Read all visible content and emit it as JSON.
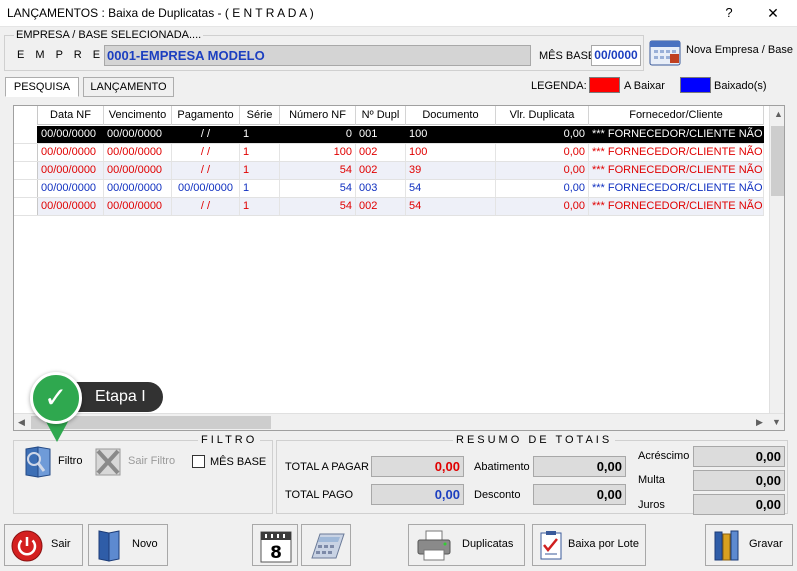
{
  "window": {
    "title": "LANÇAMENTOS : Baixa de Duplicatas - ( E N T R A D A )",
    "help": "?",
    "close": "✕"
  },
  "empresa": {
    "caption": "EMPRESA  /  BASE  SELECIONADA....",
    "label": "E M P R E S A",
    "value": "0001-EMPRESA MODELO",
    "mes_label": "MÊS BASE",
    "mes_value": "00/0000",
    "nova_button": "Nova Empresa / Base"
  },
  "tabs": [
    {
      "label": "PESQUISA",
      "active": true
    },
    {
      "label": "LANÇAMENTO",
      "active": false
    }
  ],
  "legend": {
    "label": "LEGENDA:",
    "items": [
      {
        "label": "A Baixar",
        "color": "#ff0000"
      },
      {
        "label": "Baixado(s)",
        "color": "#0000ff"
      }
    ]
  },
  "grid": {
    "columns": [
      "Data NF",
      "Vencimento",
      "Pagamento",
      "Série",
      "Número NF",
      "Nº Dupl",
      "Documento",
      "Vlr. Duplicata",
      "Fornecedor/Cliente"
    ],
    "rows": [
      {
        "status": "sel",
        "cells": [
          "00/00/0000",
          "00/00/0000",
          "/ /",
          "1",
          "0",
          "001",
          "100",
          "0,00",
          "*** FORNECEDOR/CLIENTE  NÃO"
        ]
      },
      {
        "status": "red",
        "cells": [
          "00/00/0000",
          "00/00/0000",
          "/ /",
          "1",
          "100",
          "002",
          "100",
          "0,00",
          "*** FORNECEDOR/CLIENTE  NÃO"
        ]
      },
      {
        "status": "red",
        "cells": [
          "00/00/0000",
          "00/00/0000",
          "/ /",
          "1",
          "54",
          "002",
          "39",
          "0,00",
          "*** FORNECEDOR/CLIENTE  NÃO"
        ]
      },
      {
        "status": "blue",
        "cells": [
          "00/00/0000",
          "00/00/0000",
          "00/00/0000",
          "1",
          "54",
          "003",
          "54",
          "0,00",
          "*** FORNECEDOR/CLIENTE  NÃO"
        ]
      },
      {
        "status": "red",
        "cells": [
          "00/00/0000",
          "00/00/0000",
          "/ /",
          "1",
          "54",
          "002",
          "54",
          "0,00",
          "*** FORNECEDOR/CLIENTE  NÃO"
        ]
      }
    ]
  },
  "callout": {
    "label": "Etapa I"
  },
  "filtro": {
    "caption": "FILTRO",
    "filtro_button": "Filtro",
    "sair_filtro_button": "Sair Filtro",
    "mes_base_check": "MÊS BASE"
  },
  "resumo": {
    "caption": "RESUMO  DE  TOTAIS",
    "total_pagar_label": "TOTAL A PAGAR",
    "total_pagar_value": "0,00",
    "total_pago_label": "TOTAL PAGO",
    "total_pago_value": "0,00",
    "abatimento_label": "Abatimento",
    "abatimento_value": "0,00",
    "desconto_label": "Desconto",
    "desconto_value": "0,00",
    "acrescimo_label": "Acréscimo",
    "acrescimo_value": "0,00",
    "multa_label": "Multa",
    "multa_value": "0,00",
    "juros_label": "Juros",
    "juros_value": "0,00"
  },
  "footer": {
    "sair": "Sair",
    "novo": "Novo",
    "calendar_day": "8",
    "duplicatas": "Duplicatas",
    "baixa_lote": "Baixa por Lote",
    "gravar": "Gravar"
  },
  "colors": {
    "accent_blue": "#1c3fc0",
    "red": "#e00000",
    "green_badge": "#2fa84f"
  }
}
